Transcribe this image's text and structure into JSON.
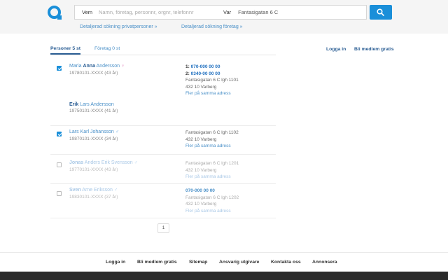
{
  "search": {
    "who_label": "Vem",
    "who_placeholder": "Namn, företag, personnr, orgnr, telefonnr",
    "where_label": "Var",
    "where_value": "Fantasigatan 6 C"
  },
  "advanced": {
    "private": "Detaljerad sökning privatpersoner »",
    "company": "Detaljerad sökning företag »"
  },
  "tabs": [
    {
      "label": "Personer 5 st",
      "active": true
    },
    {
      "label": "Företag 0 st",
      "active": false
    }
  ],
  "top_links": {
    "login": "Logga in",
    "member": "Bli medlem gratis"
  },
  "persons": [
    {
      "first": "Maria",
      "given": "Anna",
      "last": "Andersson",
      "gender": "female",
      "pid": "19780101-XXXX (43 år)",
      "phones": [
        {
          "n": "1:",
          "num": "070-000 00 00"
        },
        {
          "n": "2:",
          "num": "0340-00 00 00"
        }
      ],
      "address1": "Fantasigatan 6 C lgh 1101",
      "address2": "432 10 Varberg",
      "more": "Fler på samma adress"
    },
    {
      "first": "",
      "given": "Erik",
      "last": "Lars Andersson",
      "gender": "",
      "pid": "19750101-XXXX (41 år)"
    },
    {
      "first": "Lars Karl",
      "given": "",
      "last": "Johansson",
      "gender": "male",
      "pid": "19870101-XXXX (34 år)",
      "address1": "Fantasigatan 6 C lgh 1102",
      "address2": "432 10 Varberg",
      "more": "Fler på samma adress"
    },
    {
      "first": "",
      "given": "Jonas",
      "last": "Anders Erik Svensson",
      "gender": "male",
      "pid": "19770101-XXXX (43 år)",
      "address1": "Fantasigatan 6 C lgh 1201",
      "address2": "432 10 Varberg",
      "more": "Fler på samma adress"
    },
    {
      "first": "",
      "given": "Sven",
      "last": "Arne Eriksson",
      "gender": "male",
      "pid": "19830101-XXXX (37 år)",
      "phones": [
        {
          "n": "",
          "num": "070-000 00 00"
        }
      ],
      "address1": "Fantasigatan 6 C lgh 1202",
      "address2": "432 10 Varberg",
      "more": "Fler på samma adress"
    }
  ],
  "pager": {
    "page": "1"
  },
  "footer": [
    "Logga in",
    "Bli medlem gratis",
    "Sitemap",
    "Ansvarig utgivare",
    "Kontakta oss",
    "Annonsera"
  ],
  "colors": {
    "accent": "#1a8fd9",
    "link": "#4a90c8",
    "dark_link": "#2b5e94",
    "bottombar": "#2b2b2b"
  }
}
